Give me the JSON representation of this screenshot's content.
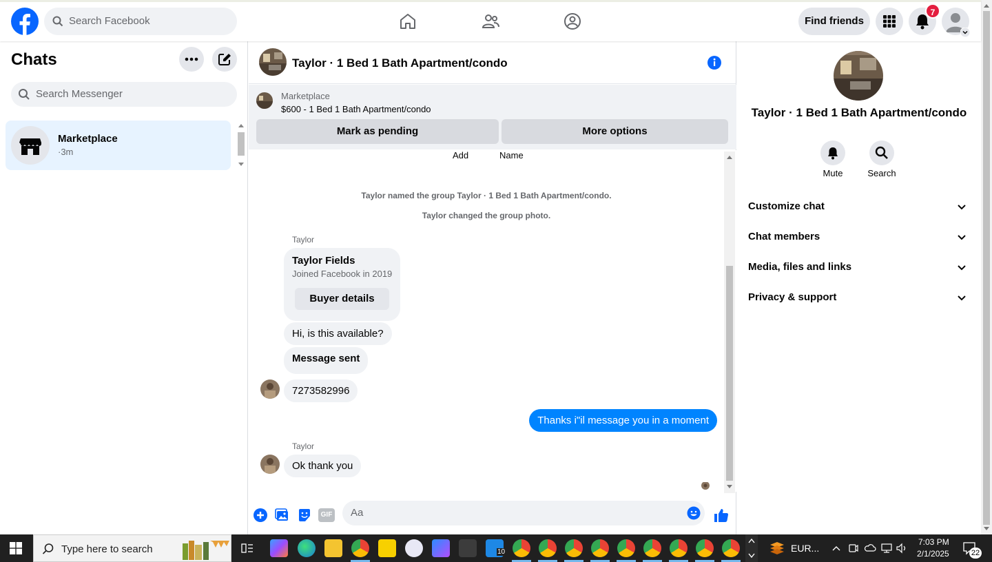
{
  "topbar": {
    "search_placeholder": "Search Facebook",
    "find_friends": "Find friends",
    "notifications_count": "7"
  },
  "left": {
    "title": "Chats",
    "search_placeholder": "Search Messenger",
    "chats": [
      {
        "name": "Marketplace",
        "time": "·3m"
      }
    ]
  },
  "conversation": {
    "title": "Taylor · 1 Bed 1 Bath Apartment/condo",
    "marketplace_label": "Marketplace",
    "listing": "$600 - 1 Bed 1 Bath Apartment/condo",
    "mark_pending": "Mark as pending",
    "more_options": "More options",
    "top_links": [
      "Add",
      "Name"
    ],
    "system_messages": [
      "Taylor named the group Taylor · 1 Bed 1 Bath Apartment/condo.",
      "Taylor changed the group photo."
    ],
    "sender_name": "Taylor",
    "buyer_card": {
      "name": "Taylor Fields",
      "sub": "Joined Facebook in 2019",
      "button": "Buyer details"
    },
    "messages": [
      "Hi, is this available?",
      "Message sent",
      "7273582996",
      "Thanks i\"il message you in a moment",
      "Ok thank you"
    ],
    "composer_placeholder": "Aa",
    "gif_label": "GIF"
  },
  "right": {
    "title": "Taylor · 1 Bed 1 Bath Apartment/condo",
    "mute": "Mute",
    "search": "Search",
    "sections": [
      "Customize chat",
      "Chat members",
      "Media, files and links",
      "Privacy & support"
    ]
  },
  "taskbar": {
    "search_placeholder": "Type here to search",
    "currency": "EUR...",
    "time": "7:03 PM",
    "date": "2/1/2025",
    "notif_count": "22",
    "badge_10": "10"
  },
  "colors": {
    "brand": "#0866ff",
    "outgoing_bubble": "#0084ff",
    "chat_selected": "#e7f3ff",
    "notification_badge": "#e41e3f"
  }
}
